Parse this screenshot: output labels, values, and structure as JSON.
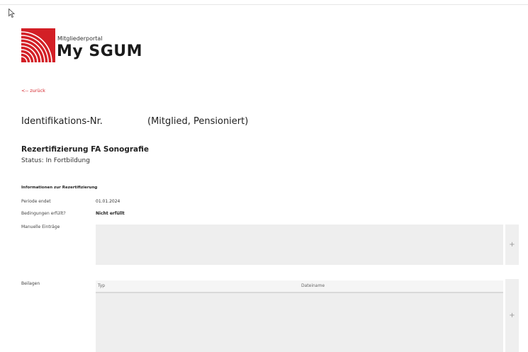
{
  "header": {
    "portal_subtitle": "Mitgliederportal",
    "portal_title": "My SGUM"
  },
  "nav": {
    "back_label": "<-- zurück"
  },
  "member": {
    "id_label": "Identifikations-Nr.",
    "status_label": "(Mitglied, Pensioniert)"
  },
  "recert": {
    "title": "Rezertifizierung FA Sonografie",
    "status": "Status: In Fortbildung",
    "info_heading": "Informationen zur Rezertifizierung",
    "period_label": "Periode endet",
    "period_value": "01.01.2024",
    "conditions_label": "Bedingungen erfüllt?",
    "conditions_value": "Nicht erfüllt",
    "manual_label": "Manuelle Einträge",
    "attachments_label": "Beilagen",
    "col_type": "Typ",
    "col_filename": "Dateiname",
    "add_symbol": "+"
  },
  "colors": {
    "brand_red": "#d31f26",
    "panel_gray": "#eeeeee"
  },
  "icons": {
    "cursor": "mouse-pointer-icon",
    "logo": "sgum-logo-icon",
    "add": "plus-icon"
  }
}
